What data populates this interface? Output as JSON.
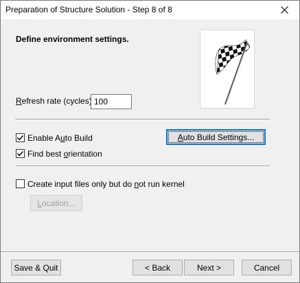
{
  "window": {
    "title": "Preparation of Structure Solution - Step 8 of 8"
  },
  "heading": "Define environment settings.",
  "refresh_rate": {
    "label_prefix": "",
    "label_underlined": "R",
    "label_rest": "efresh rate (cycles):",
    "value": "100"
  },
  "checkboxes": {
    "enable_auto_build": {
      "pre": "Enable A",
      "ul": "u",
      "post": "to Build",
      "checked": true
    },
    "find_best_orientation": {
      "pre": "Find best ",
      "ul": "o",
      "post": "rientation",
      "checked": true
    },
    "create_input_only": {
      "pre": "Create input files only but do ",
      "ul": "n",
      "post": "ot run kernel",
      "checked": false
    }
  },
  "buttons": {
    "auto_build_settings": {
      "pre": "",
      "ul": "A",
      "post": "uto Build Settings..."
    },
    "location": {
      "pre": "",
      "ul": "L",
      "post": "ocation..."
    },
    "save_quit": "Save & Quit",
    "back": "< Back",
    "next": "Next >",
    "cancel": "Cancel"
  },
  "icons": {
    "close": "close-icon",
    "flag": "checkered-flag-icon",
    "check": "checkmark-icon"
  },
  "colors": {
    "accent_border": "#0078d7",
    "dialog_bg": "#f0f0f0"
  }
}
